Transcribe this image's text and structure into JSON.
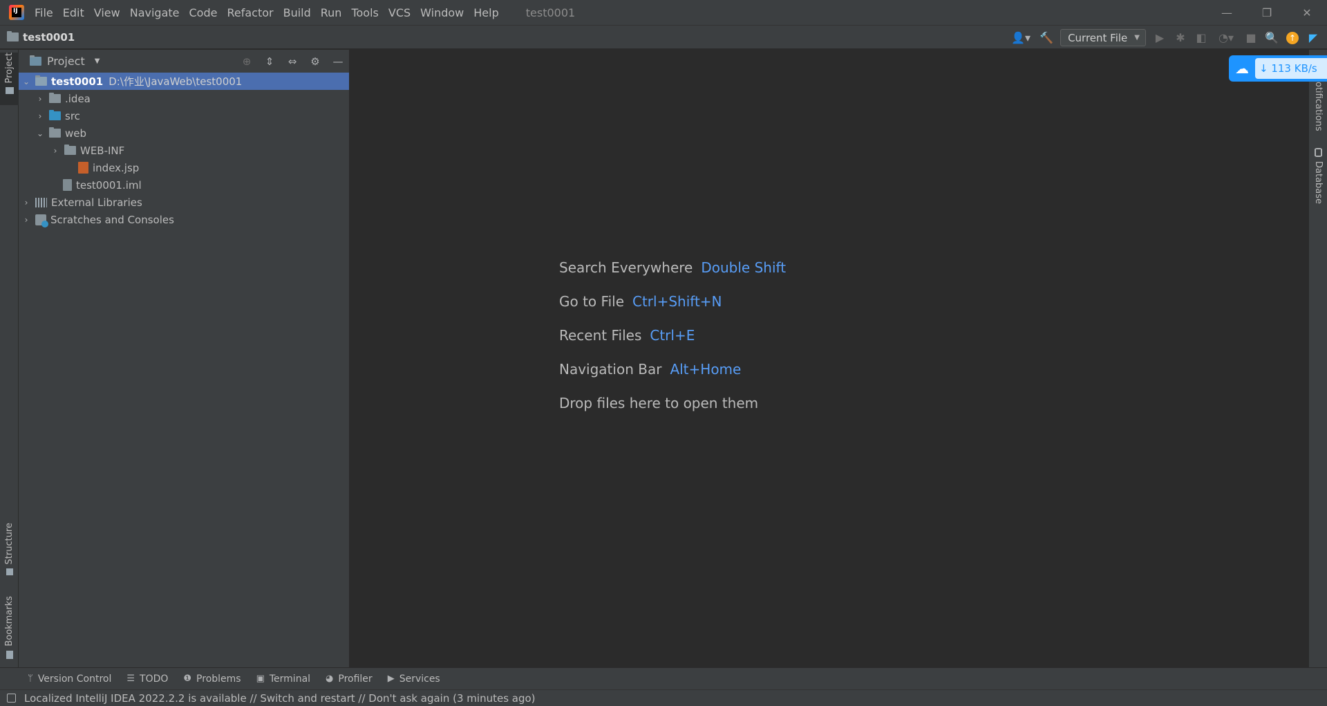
{
  "app": {
    "logo_text": "IJ",
    "window_title": "test0001"
  },
  "menu": [
    "File",
    "Edit",
    "View",
    "Navigate",
    "Code",
    "Refactor",
    "Build",
    "Run",
    "Tools",
    "VCS",
    "Window",
    "Help"
  ],
  "window_controls": {
    "minimize": "—",
    "restore": "❐",
    "close": "✕"
  },
  "navbar": {
    "project_name": "test0001",
    "run_config_label": "Current File"
  },
  "left_stripe": {
    "project_tab": "Project",
    "structure_tab": "Structure",
    "bookmarks_tab": "Bookmarks"
  },
  "right_stripe": {
    "notifications_tab": "otifications",
    "database_tab": "Database"
  },
  "project_panel": {
    "title": "Project",
    "tree": [
      {
        "name": "test0001",
        "path": "D:\\作业\\JavaWeb\\test0001"
      },
      {
        "name": ".idea"
      },
      {
        "name": "src"
      },
      {
        "name": "web"
      },
      {
        "name": "WEB-INF"
      },
      {
        "name": "index.jsp"
      },
      {
        "name": "test0001.iml"
      },
      {
        "name": "External Libraries"
      },
      {
        "name": "Scratches and Consoles"
      }
    ]
  },
  "editor_hints": [
    {
      "label": "Search Everywhere",
      "key": "Double Shift"
    },
    {
      "label": "Go to File",
      "key": "Ctrl+Shift+N"
    },
    {
      "label": "Recent Files",
      "key": "Ctrl+E"
    },
    {
      "label": "Navigation Bar",
      "key": "Alt+Home"
    },
    {
      "label": "Drop files here to open them",
      "key": ""
    }
  ],
  "speed_widget": {
    "rate": "↓ 113 KB/s"
  },
  "bottom_tools": [
    "Version Control",
    "TODO",
    "Problems",
    "Terminal",
    "Profiler",
    "Services"
  ],
  "status": {
    "message": "Localized IntelliJ IDEA 2022.2.2 is available // Switch and restart // Don't ask again (3 minutes ago)"
  },
  "colors": {
    "accent": "#589df6",
    "selection": "#4b6eaf",
    "panel": "#3c3f41",
    "editor": "#2b2b2b"
  }
}
